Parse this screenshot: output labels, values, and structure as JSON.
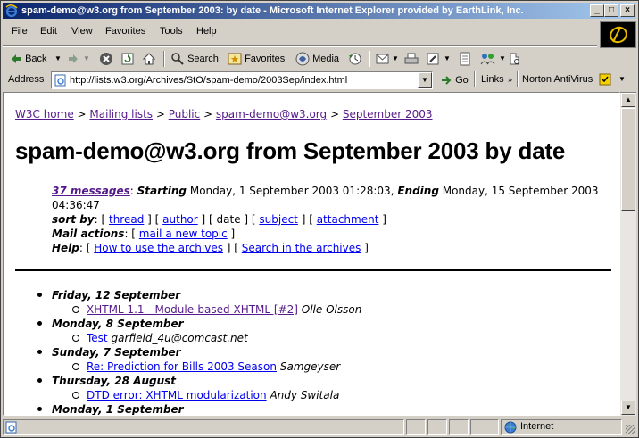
{
  "window": {
    "title": "spam-demo@w3.org from September 2003: by date - Microsoft Internet Explorer provided by EarthLink, Inc.",
    "minimize": "_",
    "maximize": "□",
    "close": "×"
  },
  "menu": [
    "File",
    "Edit",
    "View",
    "Favorites",
    "Tools",
    "Help"
  ],
  "toolbar": {
    "back": "Back",
    "search": "Search",
    "favorites": "Favorites",
    "media": "Media"
  },
  "address": {
    "label": "Address",
    "url": "http://lists.w3.org/Archives/StO/spam-demo/2003Sep/index.html",
    "go": "Go",
    "links": "Links",
    "norton": "Norton AntiVirus"
  },
  "page": {
    "breadcrumb": {
      "w3c_home": "W3C home",
      "sep": " > ",
      "mailing_lists": "Mailing lists",
      "public": "Public",
      "list": "spam-demo@w3.org",
      "month": "September 2003"
    },
    "title": "spam-demo@w3.org from September 2003 by date",
    "summary": {
      "count_link": "37 messages",
      "colon": ": ",
      "starting_label": "Starting",
      "starting_value": " Monday, 1 September 2003 01:28:03, ",
      "ending_label": "Ending",
      "ending_value": " Monday, 15 September 2003",
      "ending_time": "04:36:47"
    },
    "sort": {
      "label": "sort by",
      "colon": ": [ ",
      "thread": "thread",
      "sep": " ] [ ",
      "author": "author",
      "date": "date",
      "subject": "subject",
      "attachment": "attachment",
      "end": " ]"
    },
    "mail_actions": {
      "label": "Mail actions",
      "colon": ": [ ",
      "new_topic": "mail a new topic",
      "end": " ]"
    },
    "help": {
      "label": "Help",
      "colon": ": [ ",
      "how_to": "How to use the archives",
      "sep": " ] [ ",
      "search": "Search in the archives",
      "end": " ]"
    },
    "days": [
      {
        "date": "Friday, 12 September",
        "message": {
          "subject": "XHTML 1.1 - Module-based XHTML [#2]",
          "author": "Olle Olsson"
        }
      },
      {
        "date": "Monday, 8 September",
        "message": {
          "subject": "Test",
          "author": "garfield_4u@comcast.net"
        }
      },
      {
        "date": "Sunday, 7 September",
        "message": {
          "subject": "Re: Prediction for Bills 2003 Season",
          "author": "Samgeyser"
        }
      },
      {
        "date": "Thursday, 28 August",
        "message": {
          "subject": "DTD error: XHTML modularization",
          "author": "Andy Switala"
        }
      },
      {
        "date": "Monday, 1 September"
      }
    ]
  },
  "status": {
    "zone": "Internet"
  }
}
